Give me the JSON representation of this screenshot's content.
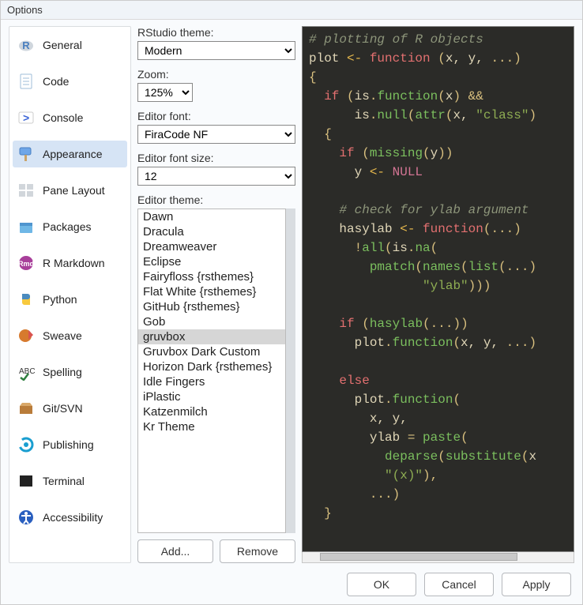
{
  "window": {
    "title": "Options"
  },
  "sidebar": {
    "items": [
      {
        "label": "General",
        "icon": "r-logo-icon",
        "color": "#4a7fbf"
      },
      {
        "label": "Code",
        "icon": "doc-icon",
        "color": "#9fbed8"
      },
      {
        "label": "Console",
        "icon": "console-icon",
        "color": "#3a63d6"
      },
      {
        "label": "Appearance",
        "icon": "paint-icon",
        "color": "#6ea6e8",
        "selected": true
      },
      {
        "label": "Pane Layout",
        "icon": "panes-icon",
        "color": "#bcc5cd"
      },
      {
        "label": "Packages",
        "icon": "box-icon",
        "color": "#6fb7e6"
      },
      {
        "label": "R Markdown",
        "icon": "rmd-icon",
        "color": "#a83f9a"
      },
      {
        "label": "Python",
        "icon": "python-icon",
        "color": "#4b8bbe"
      },
      {
        "label": "Sweave",
        "icon": "sweave-icon",
        "color": "#d77a2e"
      },
      {
        "label": "Spelling",
        "icon": "spell-icon",
        "color": "#2e7e3e"
      },
      {
        "label": "Git/SVN",
        "icon": "git-icon",
        "color": "#b97c3a"
      },
      {
        "label": "Publishing",
        "icon": "publish-icon",
        "color": "#1a9ed0"
      },
      {
        "label": "Terminal",
        "icon": "terminal-icon",
        "color": "#222222"
      },
      {
        "label": "Accessibility",
        "icon": "a11y-icon",
        "color": "#2a5fbf"
      }
    ]
  },
  "settings": {
    "rstudio_theme": {
      "label": "RStudio theme:",
      "value": "Modern"
    },
    "zoom": {
      "label": "Zoom:",
      "value": "125%"
    },
    "editor_font": {
      "label": "Editor font:",
      "value": "FiraCode NF"
    },
    "font_size": {
      "label": "Editor font size:",
      "value": "12"
    },
    "editor_theme": {
      "label": "Editor theme:",
      "selected": "gruvbox",
      "options": [
        "Dawn",
        "Dracula",
        "Dreamweaver",
        "Eclipse",
        "Fairyfloss {rsthemes}",
        "Flat White {rsthemes}",
        "GitHub {rsthemes}",
        "Gob",
        "gruvbox",
        "Gruvbox Dark Custom",
        "Horizon Dark {rsthemes}",
        "Idle Fingers",
        "iPlastic",
        "Katzenmilch",
        "Kr Theme"
      ]
    },
    "buttons": {
      "add": "Add...",
      "remove": "Remove"
    }
  },
  "footer": {
    "ok": "OK",
    "cancel": "Cancel",
    "apply": "Apply"
  },
  "preview_code": {
    "lines": [
      [
        [
          "cm",
          "# plotting of R objects"
        ]
      ],
      [
        [
          "id",
          "plot"
        ],
        [
          "as",
          " <- "
        ],
        [
          "kw",
          "function "
        ],
        [
          "par",
          "("
        ],
        [
          "id",
          "x, y, "
        ],
        [
          "op",
          "..."
        ],
        [
          "par",
          ")"
        ]
      ],
      [
        [
          "par",
          "{"
        ]
      ],
      [
        [
          "id",
          "  "
        ],
        [
          "kw",
          "if "
        ],
        [
          "par",
          "("
        ],
        [
          "id",
          "is"
        ],
        [
          "op",
          "."
        ],
        [
          "fn",
          "function"
        ],
        [
          "par",
          "("
        ],
        [
          "id",
          "x"
        ],
        [
          "par",
          ") "
        ],
        [
          "op",
          "&&"
        ]
      ],
      [
        [
          "id",
          "      is"
        ],
        [
          "op",
          "."
        ],
        [
          "fn",
          "null"
        ],
        [
          "par",
          "("
        ],
        [
          "fn",
          "attr"
        ],
        [
          "par",
          "("
        ],
        [
          "id",
          "x, "
        ],
        [
          "str",
          "\"class\""
        ],
        [
          "par",
          ")"
        ]
      ],
      [
        [
          "id",
          "  "
        ],
        [
          "par",
          "{"
        ]
      ],
      [
        [
          "id",
          "    "
        ],
        [
          "kw",
          "if "
        ],
        [
          "par",
          "("
        ],
        [
          "fn",
          "missing"
        ],
        [
          "par",
          "("
        ],
        [
          "id",
          "y"
        ],
        [
          "par",
          "))"
        ]
      ],
      [
        [
          "id",
          "      y"
        ],
        [
          "as",
          " <- "
        ],
        [
          "cst",
          "NULL"
        ]
      ],
      [
        [
          "id",
          ""
        ]
      ],
      [
        [
          "id",
          "    "
        ],
        [
          "cm",
          "# check for ylab argument"
        ]
      ],
      [
        [
          "id",
          "    hasylab"
        ],
        [
          "as",
          " <- "
        ],
        [
          "kw",
          "function"
        ],
        [
          "par",
          "("
        ],
        [
          "op",
          "..."
        ],
        [
          "par",
          ")"
        ]
      ],
      [
        [
          "id",
          "      "
        ],
        [
          "op",
          "!"
        ],
        [
          "fn",
          "all"
        ],
        [
          "par",
          "("
        ],
        [
          "id",
          "is"
        ],
        [
          "op",
          "."
        ],
        [
          "fn",
          "na"
        ],
        [
          "par",
          "("
        ]
      ],
      [
        [
          "id",
          "        "
        ],
        [
          "fn",
          "pmatch"
        ],
        [
          "par",
          "("
        ],
        [
          "fn",
          "names"
        ],
        [
          "par",
          "("
        ],
        [
          "fn",
          "list"
        ],
        [
          "par",
          "("
        ],
        [
          "op",
          "..."
        ],
        [
          "par",
          ")"
        ]
      ],
      [
        [
          "id",
          "               "
        ],
        [
          "str",
          "\"ylab\""
        ],
        [
          "par",
          ")))"
        ]
      ],
      [
        [
          "id",
          ""
        ]
      ],
      [
        [
          "id",
          "    "
        ],
        [
          "kw",
          "if "
        ],
        [
          "par",
          "("
        ],
        [
          "fn",
          "hasylab"
        ],
        [
          "par",
          "("
        ],
        [
          "op",
          "..."
        ],
        [
          "par",
          "))"
        ]
      ],
      [
        [
          "id",
          "      plot"
        ],
        [
          "op",
          "."
        ],
        [
          "fn",
          "function"
        ],
        [
          "par",
          "("
        ],
        [
          "id",
          "x, y, "
        ],
        [
          "op",
          "..."
        ],
        [
          "par",
          ")"
        ]
      ],
      [
        [
          "id",
          ""
        ]
      ],
      [
        [
          "id",
          "    "
        ],
        [
          "kw",
          "else"
        ]
      ],
      [
        [
          "id",
          "      plot"
        ],
        [
          "op",
          "."
        ],
        [
          "fn",
          "function"
        ],
        [
          "par",
          "("
        ]
      ],
      [
        [
          "id",
          "        x, y,"
        ]
      ],
      [
        [
          "id",
          "        ylab "
        ],
        [
          "op",
          "="
        ],
        [
          "id",
          " "
        ],
        [
          "fn",
          "paste"
        ],
        [
          "par",
          "("
        ]
      ],
      [
        [
          "id",
          "          "
        ],
        [
          "fn",
          "deparse"
        ],
        [
          "par",
          "("
        ],
        [
          "fn",
          "substitute"
        ],
        [
          "par",
          "("
        ],
        [
          "id",
          "x"
        ]
      ],
      [
        [
          "id",
          "          "
        ],
        [
          "str",
          "\"(x)\""
        ],
        [
          "par",
          "),"
        ]
      ],
      [
        [
          "id",
          "        "
        ],
        [
          "op",
          "..."
        ],
        [
          "par",
          ")"
        ]
      ],
      [
        [
          "id",
          "  "
        ],
        [
          "par",
          "}"
        ]
      ]
    ]
  }
}
